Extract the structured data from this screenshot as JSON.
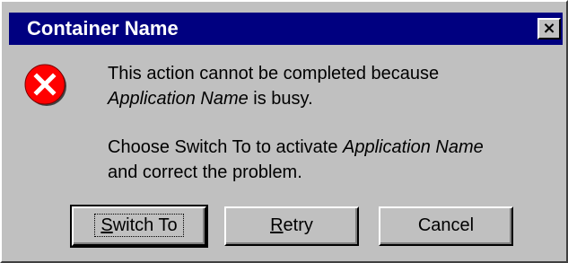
{
  "window": {
    "title": "Container Name",
    "close_label": "×"
  },
  "icon": "error-icon",
  "message": {
    "line1": "This action cannot be completed because",
    "line2_app": "Application Name",
    "line2_rest": " is busy.",
    "line3_prefix": "Choose Switch To to activate ",
    "line3_app": "Application Name",
    "line4": "and correct the problem."
  },
  "buttons": {
    "switch_to": {
      "mnemonic": "S",
      "rest": "witch To"
    },
    "retry": {
      "mnemonic": "R",
      "rest": "etry"
    },
    "cancel": {
      "label": "Cancel"
    }
  },
  "colors": {
    "title_bar": "#000080",
    "face": "#c0c0c0",
    "error_red": "#ff0000"
  }
}
